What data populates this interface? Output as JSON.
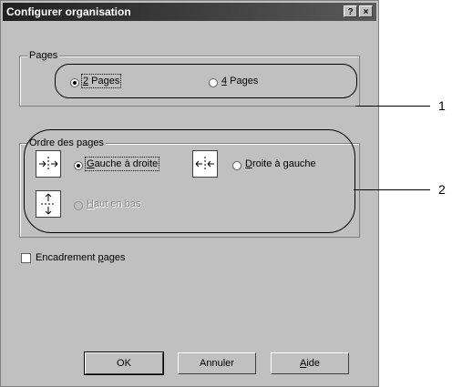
{
  "dialog": {
    "title": "Configurer organisation",
    "help_button": "?",
    "close_button": "×"
  },
  "pages_group": {
    "legend": "Pages",
    "options": [
      {
        "label_ul": "2",
        "label_rest": " Pages",
        "checked": true
      },
      {
        "label_ul": "4",
        "label_rest": " Pages",
        "checked": false
      }
    ]
  },
  "order_group": {
    "legend": "Ordre des pages",
    "options": [
      {
        "label_ul": "G",
        "label_rest": "auche à droite",
        "checked": true,
        "icon": "arrows-left-right-icon"
      },
      {
        "label_ul": "D",
        "label_rest": "roite à gauche",
        "checked": false,
        "icon": "arrows-right-left-icon"
      },
      {
        "label_ul": "H",
        "label_rest": "aut en bas",
        "checked": false,
        "disabled": true,
        "icon": "arrows-up-down-icon"
      }
    ]
  },
  "frame_checkbox": {
    "label_pre": "Encadrement ",
    "label_ul": "p",
    "label_rest": "ages",
    "checked": false
  },
  "buttons": {
    "ok": "OK",
    "cancel": "Annuler",
    "help_ul": "A",
    "help_rest": "ide"
  },
  "callouts": {
    "one": "1",
    "two": "2"
  }
}
